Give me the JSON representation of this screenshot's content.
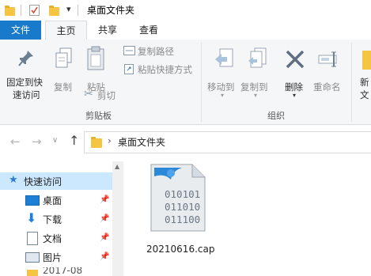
{
  "quick_access_toolbar": {
    "folder_icon": "folder-icon",
    "dropdown_glyph": "▾",
    "window_title": "桌面文件夹"
  },
  "tabs": [
    {
      "label": "文件"
    },
    {
      "label": "主页"
    },
    {
      "label": "共享"
    },
    {
      "label": "查看"
    }
  ],
  "ribbon": {
    "clipboard": {
      "pin_label_line1": "固定到快",
      "pin_label_line2": "速访问",
      "copy_label": "复制",
      "paste_label": "粘贴",
      "copy_path_label": "复制路径",
      "paste_shortcut_label": "粘贴快捷方式",
      "cut_label": "剪切",
      "group_label": "剪贴板"
    },
    "organize": {
      "move_to_label": "移动到",
      "copy_to_label": "复制到",
      "delete_label": "删除",
      "rename_label": "重命名",
      "group_label": "组织"
    },
    "new": {
      "new_label_line1": "新",
      "new_label_line2": "文"
    }
  },
  "address_bar": {
    "back": "←",
    "forward": "→",
    "recent": "∨",
    "up": "↑",
    "separator": "›",
    "path": "桌面文件夹"
  },
  "nav_pane": {
    "quick_access_label": "快速访问",
    "items": [
      {
        "label": "桌面",
        "icon": "desktop-icon"
      },
      {
        "label": "下载",
        "icon": "download-icon"
      },
      {
        "label": "文档",
        "icon": "document-icon"
      },
      {
        "label": "图片",
        "icon": "pictures-icon"
      },
      {
        "label": "2017-08"
      }
    ],
    "pin_glyph": "📌"
  },
  "content": {
    "file": {
      "name": "20210616.cap",
      "binary_lines": [
        "010101",
        "011010",
        "011100"
      ]
    }
  },
  "colors": {
    "file_tab_bg": "#1979ca",
    "selection_bg": "#cce8ff",
    "folder_yellow": "#f5c542",
    "accent_blue": "#1979ca"
  }
}
